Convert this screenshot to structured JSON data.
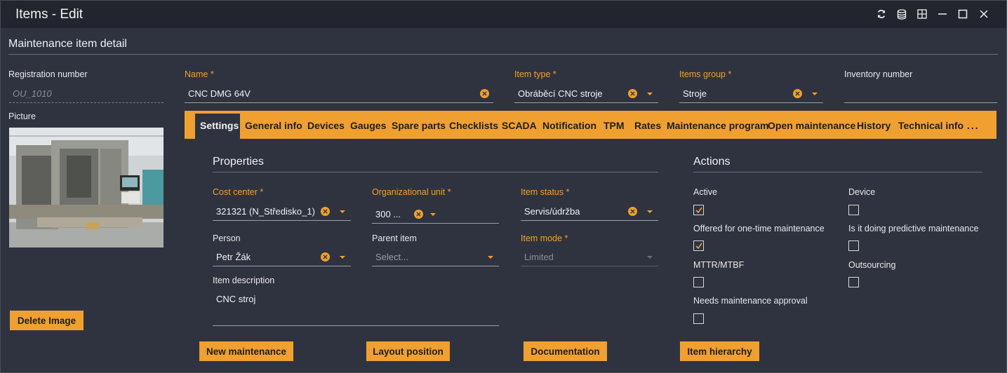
{
  "window": {
    "title": "Items - Edit",
    "controls": [
      "refresh-icon",
      "database-icon",
      "grid-icon",
      "minimize-icon",
      "maximize-icon",
      "close-icon"
    ]
  },
  "header": {
    "title": "Maintenance item detail"
  },
  "left": {
    "registration_label": "Registration number",
    "registration_placeholder": "OU_1010",
    "picture_label": "Picture",
    "delete_image": "Delete Image"
  },
  "top_fields": {
    "name": {
      "label": "Name *",
      "value": "CNC DMG 64V"
    },
    "item_type": {
      "label": "Item type *",
      "value": "Obráběcí CNC stroje"
    },
    "items_group": {
      "label": "Items group *",
      "value": "Stroje"
    },
    "inventory_number": {
      "label": "Inventory number",
      "value": ""
    }
  },
  "tabs": [
    {
      "label": "Settings",
      "active": true
    },
    {
      "label": "General info"
    },
    {
      "label": "Devices"
    },
    {
      "label": "Gauges"
    },
    {
      "label": "Spare parts"
    },
    {
      "label": "Checklists"
    },
    {
      "label": "SCADA"
    },
    {
      "label": "Notification"
    },
    {
      "label": "TPM"
    },
    {
      "label": "Rates"
    },
    {
      "label": "Maintenance program"
    },
    {
      "label": "Open maintenance"
    },
    {
      "label": "History"
    },
    {
      "label": "Technical info"
    },
    {
      "label": "..."
    }
  ],
  "properties": {
    "title": "Properties",
    "cost_center": {
      "label": "Cost center *",
      "value": "321321 (N_Středisko_1)"
    },
    "org_unit": {
      "label": "Organizational unit *",
      "value": "300 ..."
    },
    "item_status": {
      "label": "Item status *",
      "value": "Servis/údržba"
    },
    "person": {
      "label": "Person",
      "value": "Petr Žák"
    },
    "parent_item": {
      "label": "Parent item",
      "placeholder": "Select..."
    },
    "item_mode": {
      "label": "Item mode *",
      "value": "Limited"
    },
    "description": {
      "label": "Item description",
      "value": "CNC stroj"
    }
  },
  "actions": {
    "title": "Actions",
    "checkboxes": [
      {
        "label": "Active",
        "checked": true
      },
      {
        "label": "Device",
        "checked": false
      },
      {
        "label": "Offered for one-time maintenance",
        "checked": true
      },
      {
        "label": "Is it doing predictive maintenance",
        "checked": false
      },
      {
        "label": "MTTR/MTBF",
        "checked": false
      },
      {
        "label": "Outsourcing",
        "checked": false
      },
      {
        "label": "Needs maintenance approval",
        "checked": false
      }
    ]
  },
  "buttons": {
    "new_maintenance": "New maintenance",
    "layout_position": "Layout position",
    "documentation": "Documentation",
    "item_hierarchy": "Item hierarchy"
  },
  "colors": {
    "accent": "#f0a030",
    "background": "#2f3340",
    "titlebar": "#22252d"
  }
}
